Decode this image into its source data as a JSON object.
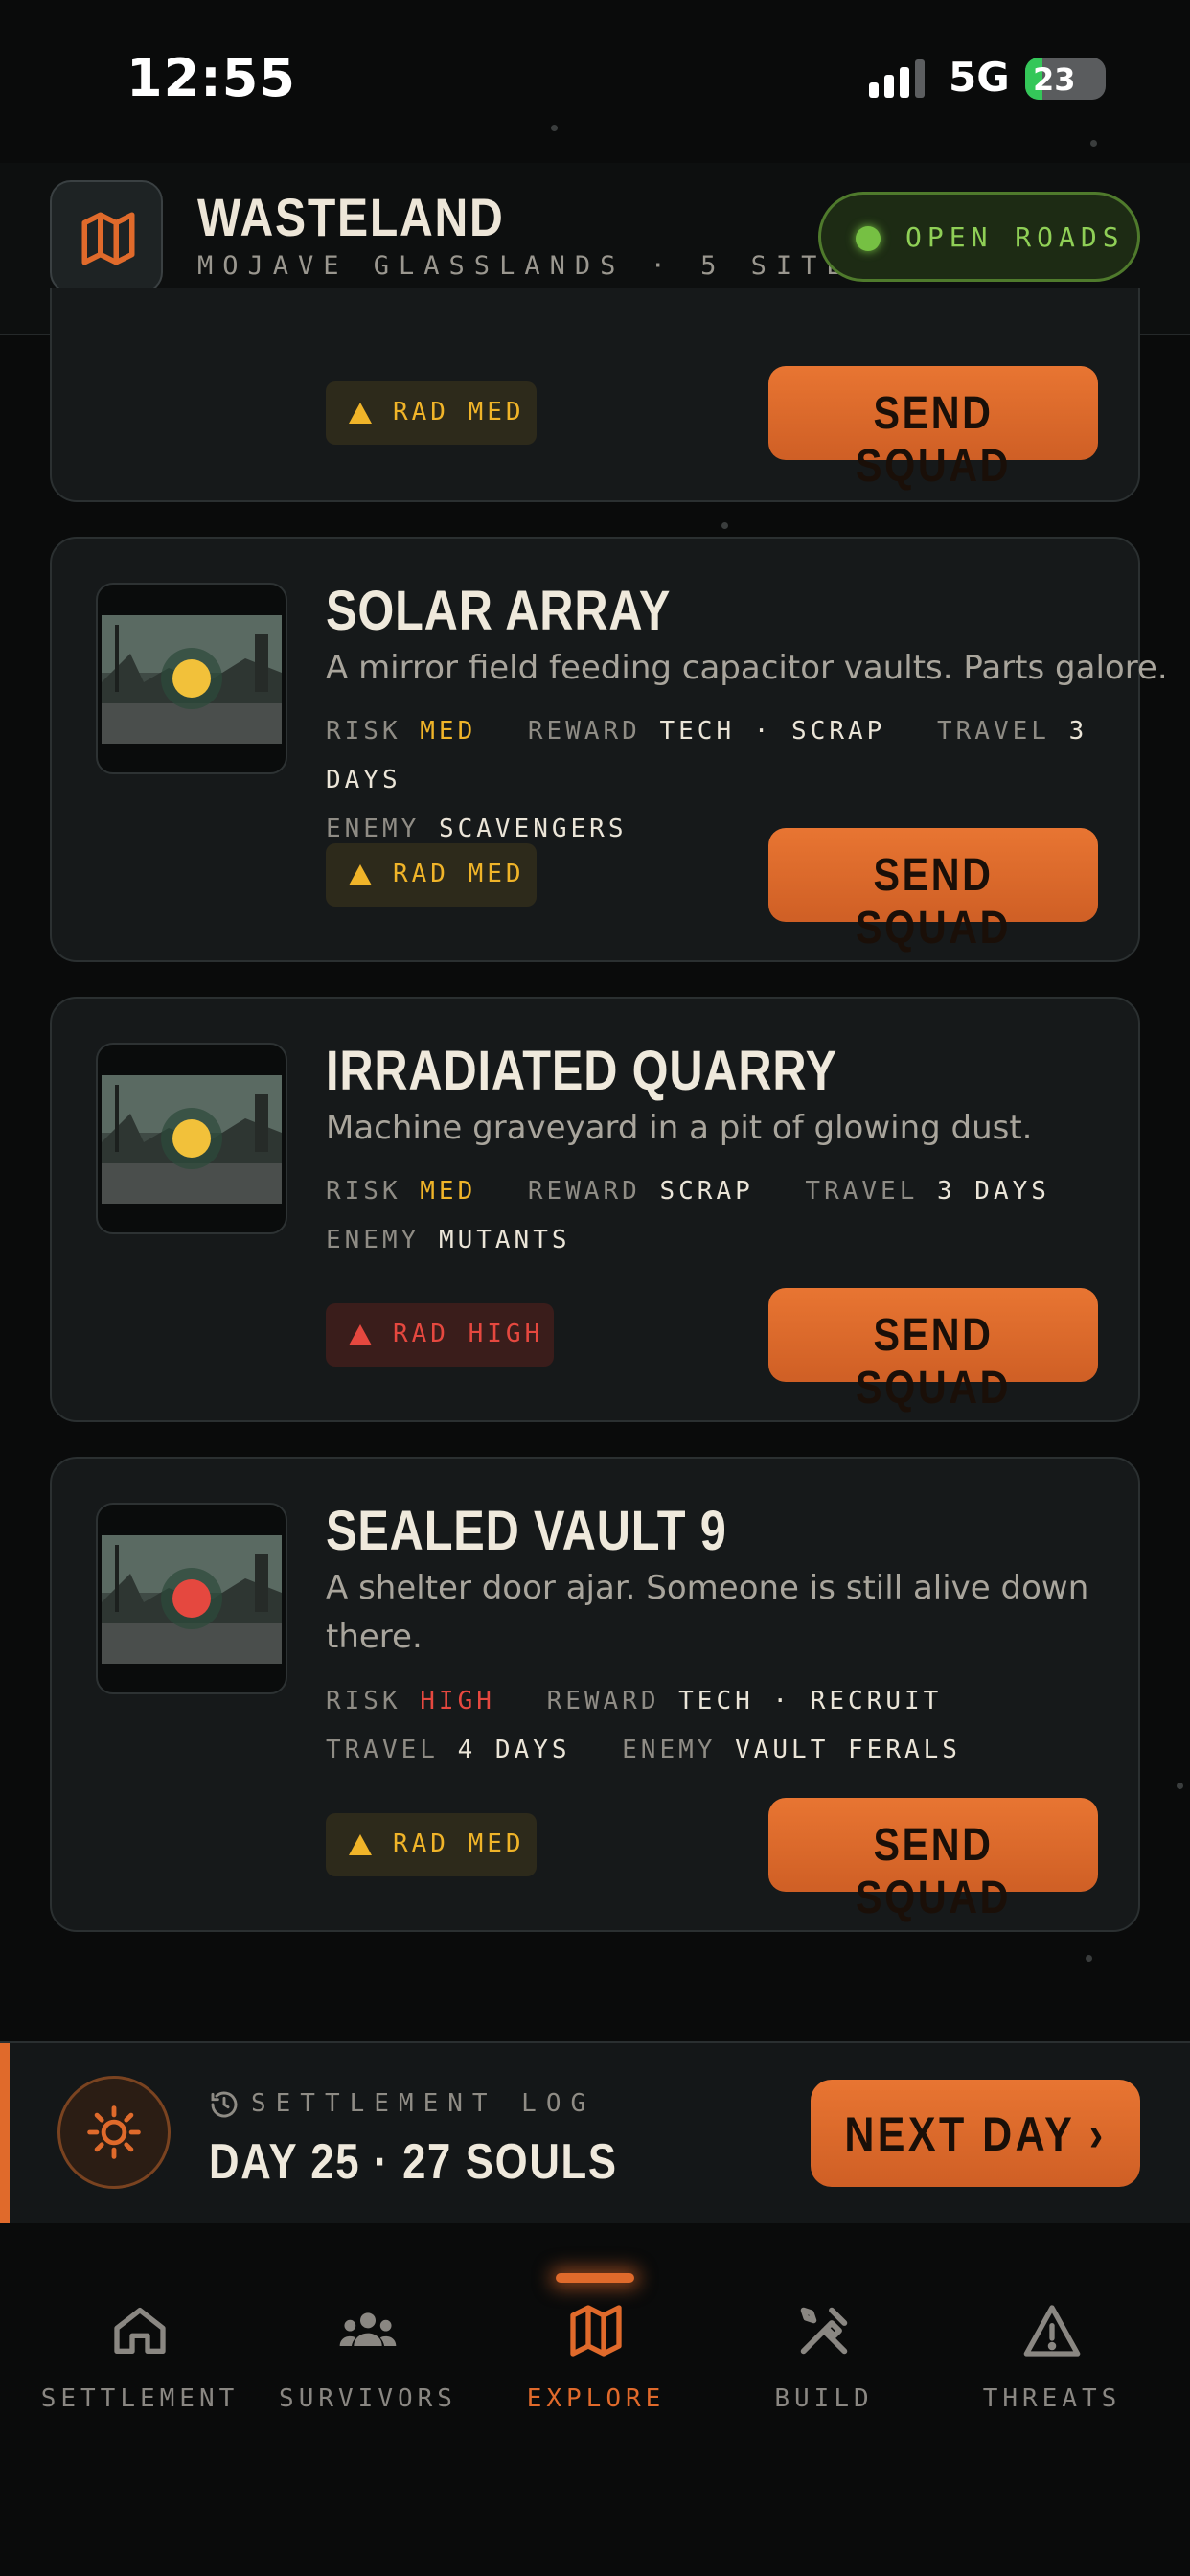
{
  "status_bar": {
    "time": "12:55",
    "network": "5G",
    "battery": "23"
  },
  "header": {
    "title": "WASTELAND",
    "subtitle": "MOJAVE GLASSLANDS · 5 SITES",
    "status_pill": "OPEN ROADS",
    "accent_color": "#e06a2b",
    "status_color": "#76c043"
  },
  "partial_card": {
    "rad_label": "RAD MED",
    "button_label": "SEND SQUAD"
  },
  "sites": [
    {
      "title": "SOLAR ARRAY",
      "description": "A mirror field feeding capacitor vaults. Parts galore.",
      "risk_key": "RISK",
      "risk": "MED",
      "reward_key": "REWARD",
      "reward": "TECH · SCRAP",
      "travel_key": "TRAVEL",
      "travel": "3 DAYS",
      "enemy_key": "ENEMY",
      "enemy": "SCAVENGERS",
      "rad_label": "RAD MED",
      "button_label": "SEND SQUAD",
      "indicator_color": "#f2c13a"
    },
    {
      "title": "IRRADIATED QUARRY",
      "description": "Machine graveyard in a pit of glowing dust.",
      "risk_key": "RISK",
      "risk": "MED",
      "reward_key": "REWARD",
      "reward": "SCRAP",
      "travel_key": "TRAVEL",
      "travel": "3 DAYS",
      "enemy_key": "ENEMY",
      "enemy": "MUTANTS",
      "rad_label": "RAD HIGH",
      "button_label": "SEND SQUAD",
      "indicator_color": "#f2c13a"
    },
    {
      "title": "SEALED VAULT 9",
      "description": "A shelter door ajar. Someone is still alive down there.",
      "risk_key": "RISK",
      "risk": "HIGH",
      "reward_key": "REWARD",
      "reward": "TECH · RECRUIT",
      "travel_key": "TRAVEL",
      "travel": "4 DAYS",
      "enemy_key": "ENEMY",
      "enemy": "VAULT FERALS",
      "rad_label": "RAD MED",
      "button_label": "SEND SQUAD",
      "indicator_color": "#e5483f"
    }
  ],
  "settlement_log": {
    "label": "SETTLEMENT LOG",
    "summary": "DAY 25 · 27 SOULS",
    "button_label": "NEXT DAY ›"
  },
  "tabs": [
    {
      "label": "SETTLEMENT",
      "icon": "home-icon",
      "active": false
    },
    {
      "label": "SURVIVORS",
      "icon": "people-icon",
      "active": false
    },
    {
      "label": "EXPLORE",
      "icon": "map-icon",
      "active": true
    },
    {
      "label": "BUILD",
      "icon": "tools-icon",
      "active": false
    },
    {
      "label": "THREATS",
      "icon": "warning-icon",
      "active": false
    }
  ]
}
